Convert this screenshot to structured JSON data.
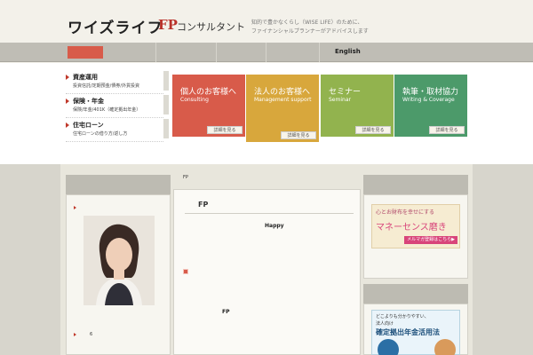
{
  "header": {
    "logo_text": "ワイズライフ",
    "logo_fp": "FP",
    "logo_sub": "コンサルタント",
    "tagline_1": "知的で豊かなくらし（WISE LIFE）のために、",
    "tagline_2": "ファイナンシャルプランナーがアドバイスします"
  },
  "gnav": {
    "english": "English"
  },
  "side_menu": [
    {
      "title": "資産運用",
      "sub": "投資信託/定期預金/債券/外貨投資"
    },
    {
      "title": "保険・年金",
      "sub": "保険/年金/401K（確定拠出年金）"
    },
    {
      "title": "住宅ローン",
      "sub": "住宅ローンの借り方/返し方"
    }
  ],
  "cards": [
    {
      "title": "個人のお客様へ",
      "sub": "Consulting",
      "button": "詳細を見る"
    },
    {
      "title": "法人のお客様へ",
      "sub": "Management support",
      "button": "詳細を見る"
    },
    {
      "title": "セミナー",
      "sub": "Seminar",
      "button": "詳細を見る"
    },
    {
      "title": "執筆・取材協力",
      "sub": "Writing & Coverage",
      "button": "詳細を見る"
    }
  ],
  "breadcrumb": "FP",
  "main": {
    "title": "FP",
    "happy": "Happy",
    "fp": "FP"
  },
  "left_col": {
    "note": "6"
  },
  "banner1": {
    "line1": "心とお財布を幸せにする",
    "line2": "マネーセンス磨き",
    "button": "メルマガ登録はこちら▶"
  },
  "banner2": {
    "line1": "どこよりも分かりやすい、",
    "line2": "法人向け",
    "line3": "確定拠出年金活用法"
  },
  "colors": {
    "accent_red": "#d85b4a",
    "accent_orange": "#d8a73c",
    "accent_green": "#92b34e",
    "accent_teal": "#4c9a6a"
  }
}
